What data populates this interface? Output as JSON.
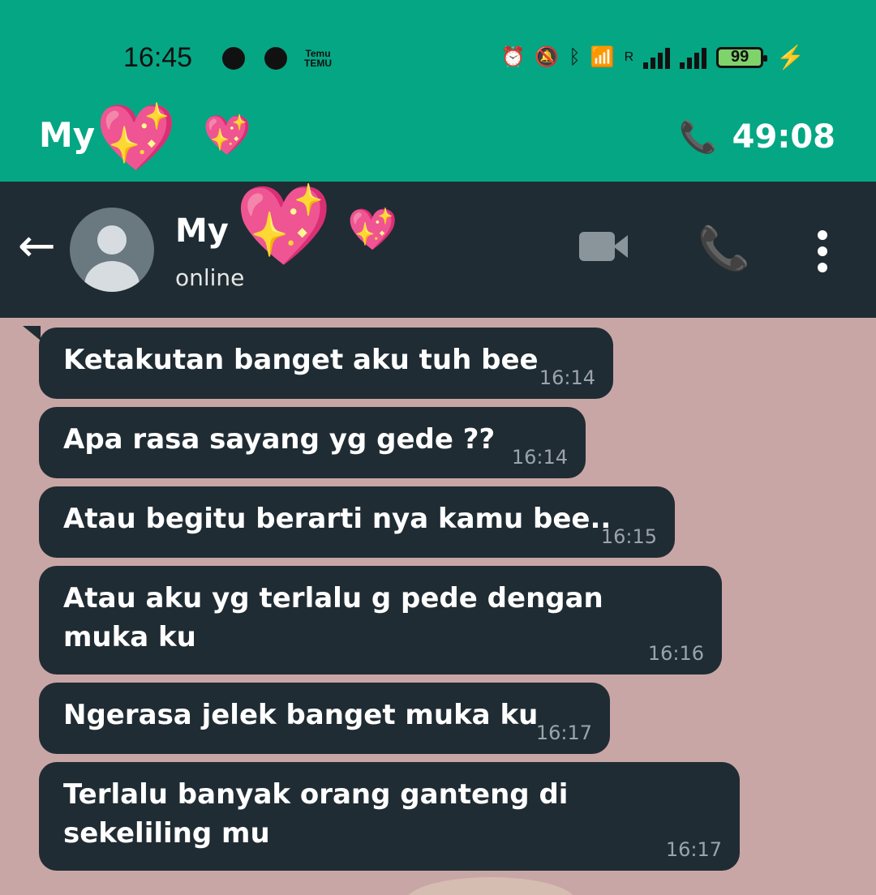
{
  "status_bar": {
    "time": "16:45",
    "temu_line1": "Temu",
    "temu_line2": "TEMU",
    "battery": "99",
    "signal_label": "R",
    "icons": [
      "messenger-icon",
      "facebook-icon",
      "temu-icon",
      "alarm-icon",
      "mute-icon",
      "bluetooth-icon",
      "wifi-icon",
      "signal-icon",
      "battery-icon",
      "charging-icon"
    ]
  },
  "call_banner": {
    "title": "My",
    "timer": "49:08"
  },
  "header": {
    "contact_name": "My",
    "status": "online"
  },
  "messages": [
    {
      "text": "Ketakutan banget aku tuh bee",
      "time": "16:14"
    },
    {
      "text": "Apa rasa sayang yg gede ??",
      "time": "16:14"
    },
    {
      "text": "Atau begitu berarti nya kamu bee..",
      "time": "16:15"
    },
    {
      "text": "Atau aku yg terlalu g pede dengan muka ku",
      "time": "16:16"
    },
    {
      "text": "Ngerasa jelek banget muka ku",
      "time": "16:17"
    },
    {
      "text": "Terlalu banyak orang ganteng di sekeliling mu",
      "time": "16:17"
    }
  ]
}
